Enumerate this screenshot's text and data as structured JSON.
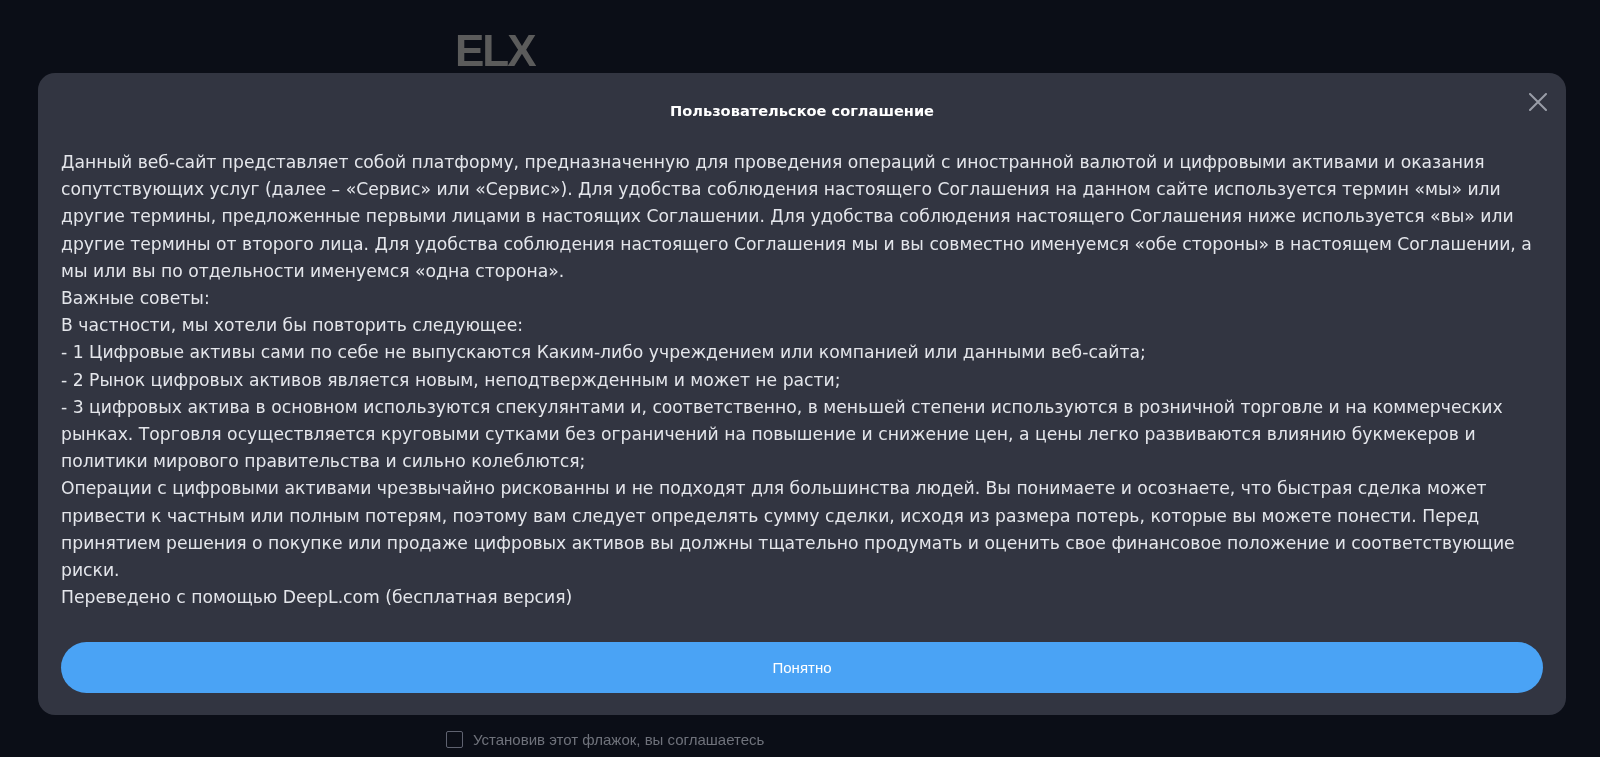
{
  "page": {
    "logo": "ELX",
    "consent": {
      "checked": false,
      "label": "Установив этот флажок, вы соглашаетесь"
    }
  },
  "dialog": {
    "title": "Пользовательское соглашение",
    "paragraphs": [
      "Данный веб-сайт представляет собой платформу, предназначенную для проведения операций с иностранной валютой и цифровыми активами и оказания сопутствующих услуг (далее – «Сервис» или «Сервис»). Для удобства соблюдения настоящего Соглашения на данном сайте используется термин «мы» или другие термины, предложенные первыми лицами в настоящих Соглашении. Для удобства соблюдения настоящего Соглашения ниже используется «вы» или другие термины от второго лица. Для удобства соблюдения настоящего Соглашения мы и вы совместно именуемся «обе стороны» в настоящем Соглашении, а мы или вы по отдельности именуемся «одна сторона».",
      "Важные советы:",
      "В частности, мы хотели бы повторить следующее:",
      "- 1 Цифровые активы сами по себе не выпускаются Каким-либо учреждением или компанией или данными веб-сайта;",
      "- 2 Рынок цифровых активов является новым, неподтвержденным и может не расти;",
      "- 3 цифровых актива в основном используются спекулянтами и, соответственно, в меньшей степени используются в розничной торговле и на коммерческих рынках. Торговля осуществляется круговыми сутками без ограничений на повышение и снижение цен, а цены легко развиваются влиянию букмекеров и политики мирового правительства и сильно колеблются;",
      "Операции с цифровыми активами чрезвычайно рискованны и не подходят для большинства людей. Вы понимаете и осознаете, что быстрая сделка может привести к частным или полным потерям, поэтому вам следует определять сумму сделки, исходя из размера потерь, которые вы можете понести. Перед принятием решения о покупке или продаже цифровых активов вы должны тщательно продумать и оценить свое финансовое положение и соответствующие риски.",
      "Переведено с помощью DeepL.com (бесплатная версия)"
    ],
    "button": "Понятно"
  }
}
